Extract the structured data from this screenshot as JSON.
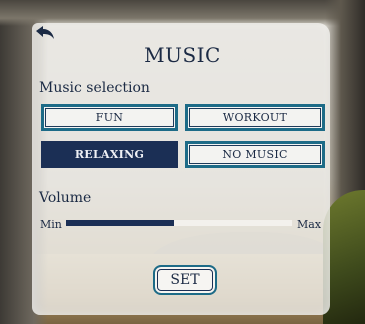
{
  "screen": {
    "title": "MUSIC",
    "back_icon": "back-arrow-icon"
  },
  "music_selection": {
    "label": "Music selection",
    "options": [
      {
        "label": "FUN",
        "selected": false
      },
      {
        "label": "WORKOUT",
        "selected": false
      },
      {
        "label": "RELAXING",
        "selected": true
      },
      {
        "label": "NO MUSIC",
        "selected": false
      }
    ]
  },
  "volume": {
    "label": "Volume",
    "min_label": "Min",
    "max_label": "Max",
    "level": 0.48
  },
  "actions": {
    "set_label": "SET"
  },
  "colors": {
    "accent": "#1b2f55",
    "border": "#1d6b87"
  }
}
